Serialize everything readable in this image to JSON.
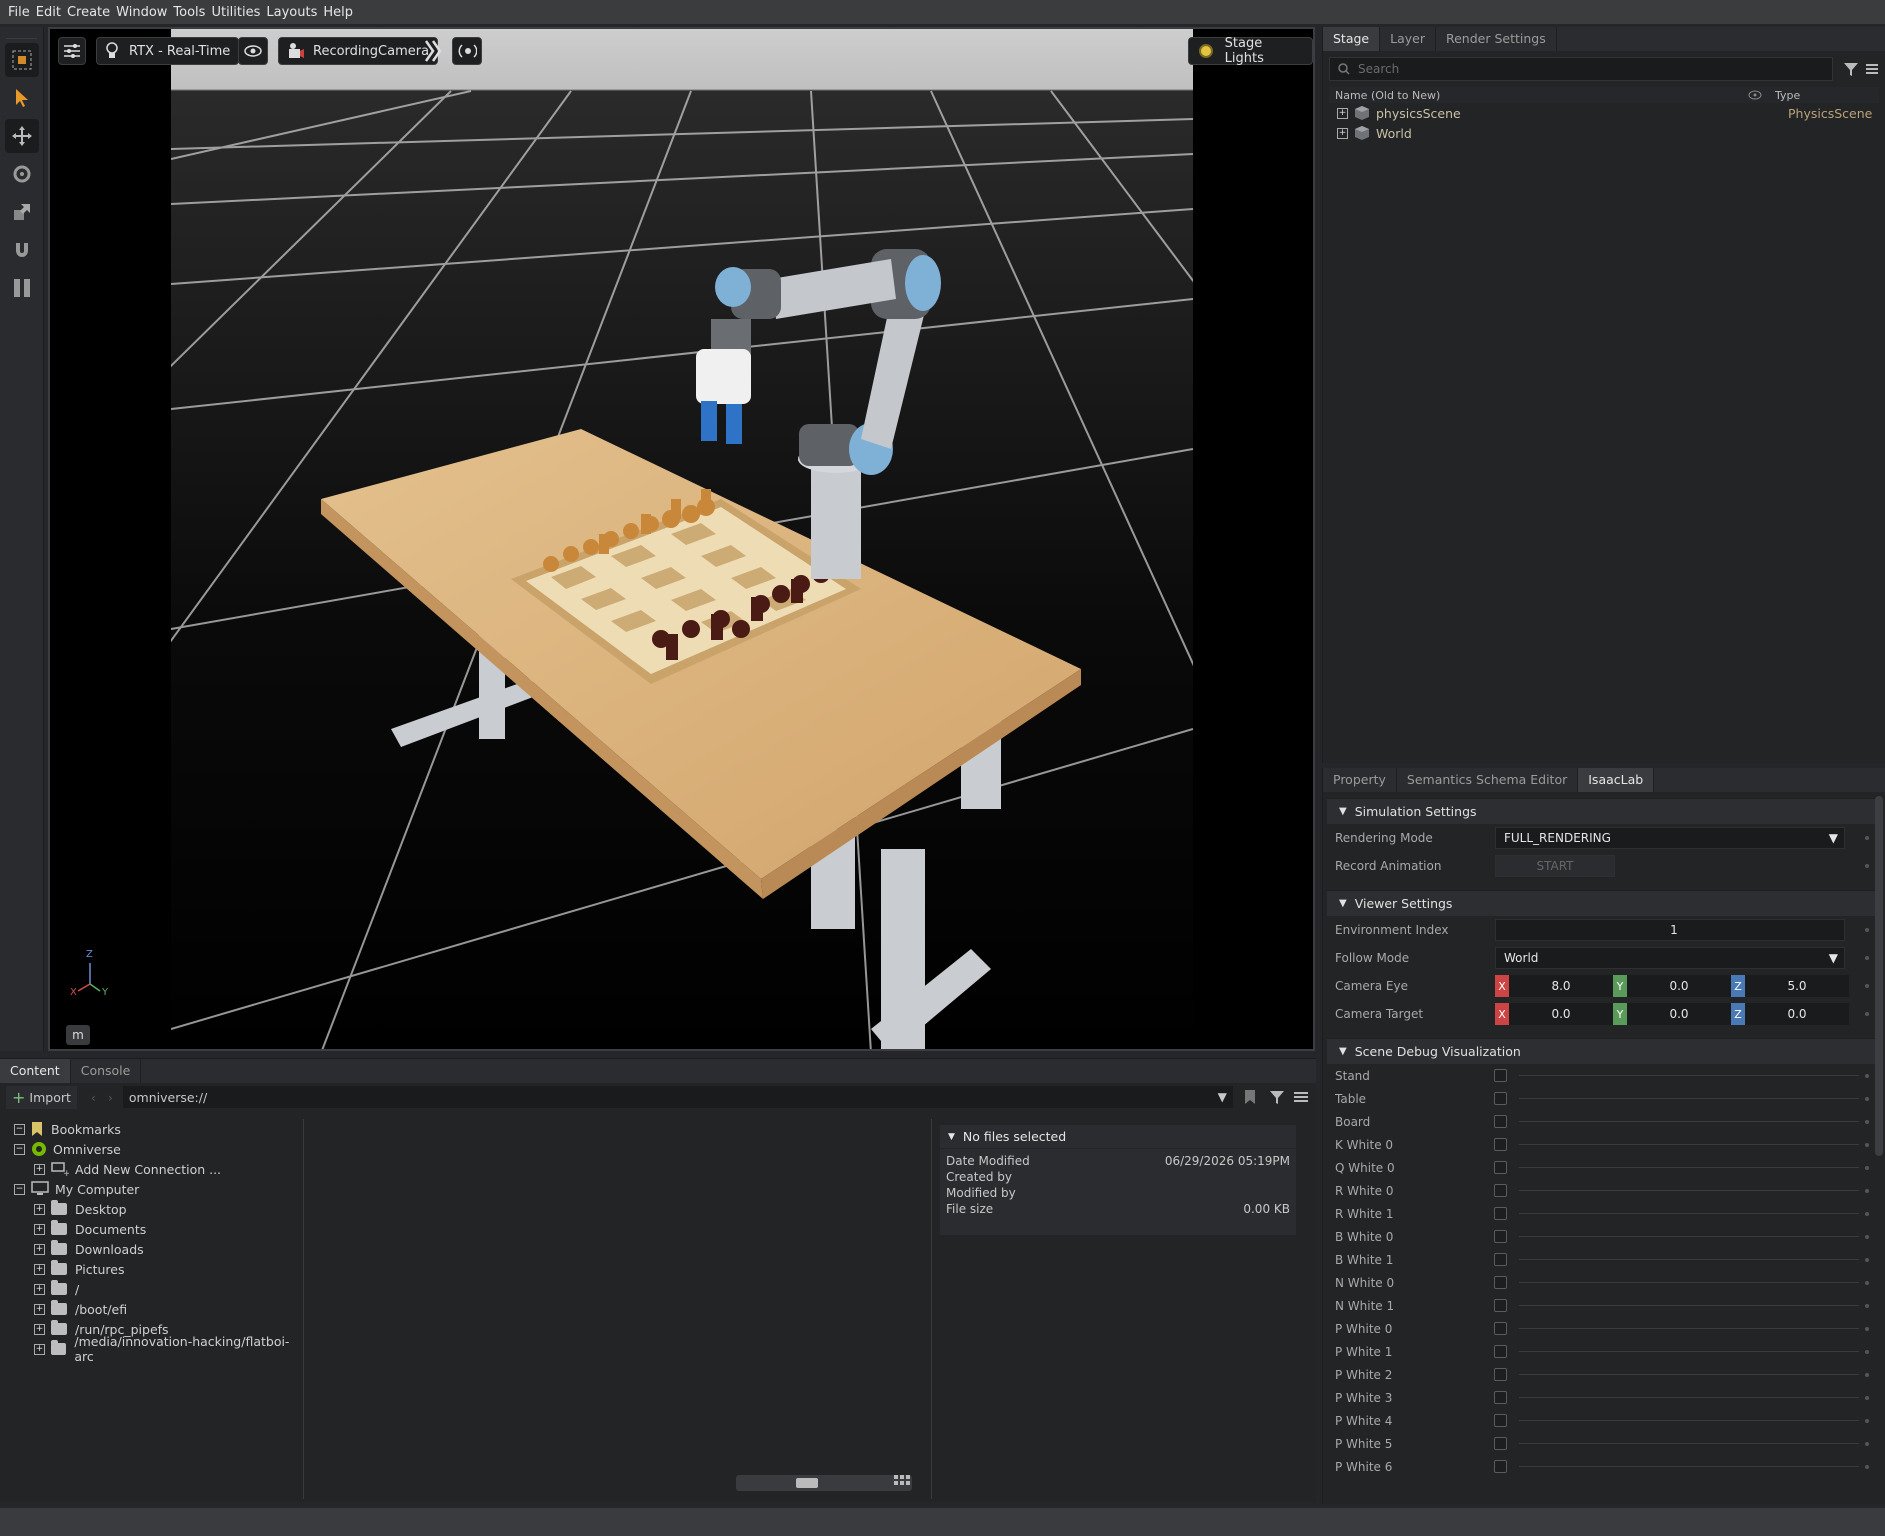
{
  "menubar": [
    "File",
    "Edit",
    "Create",
    "Window",
    "Tools",
    "Utilities",
    "Layouts",
    "Help"
  ],
  "viewport": {
    "render_mode": "RTX - Real-Time",
    "camera": "RecordingCamera",
    "stage_lights": "Stage Lights",
    "unit_badge": "m",
    "axis": {
      "z": "Z",
      "x": "X",
      "y": "Y"
    }
  },
  "stage": {
    "tabs": [
      "Stage",
      "Layer",
      "Render Settings"
    ],
    "search_placeholder": "Search",
    "col_name": "Name (Old to New)",
    "col_type": "Type",
    "items": [
      {
        "name": "physicsScene",
        "type": "PhysicsScene"
      },
      {
        "name": "World",
        "type": ""
      }
    ]
  },
  "props": {
    "tabs": [
      "Property",
      "Semantics Schema Editor",
      "IsaacLab"
    ],
    "sim_settings": "Simulation Settings",
    "rendering_mode_label": "Rendering Mode",
    "rendering_mode_value": "FULL_RENDERING",
    "record_animation_label": "Record Animation",
    "record_button": "START",
    "viewer_settings": "Viewer Settings",
    "env_index_label": "Environment Index",
    "env_index_value": "1",
    "follow_mode_label": "Follow Mode",
    "follow_mode_value": "World",
    "camera_eye_label": "Camera Eye",
    "camera_eye": [
      "8.0",
      "0.0",
      "5.0"
    ],
    "camera_target_label": "Camera Target",
    "camera_target": [
      "0.0",
      "0.0",
      "0.0"
    ],
    "axis_labels": [
      "X",
      "Y",
      "Z"
    ],
    "debug_viz": "Scene Debug Visualization",
    "debug_items": [
      "Stand",
      "Table",
      "Board",
      "K White 0",
      "Q White 0",
      "R White 0",
      "R White 1",
      "B White 0",
      "B White 1",
      "N White 0",
      "N White 1",
      "P White 0",
      "P White 1",
      "P White 2",
      "P White 3",
      "P White 4",
      "P White 5",
      "P White 6"
    ]
  },
  "content": {
    "tabs": [
      "Content",
      "Console"
    ],
    "import_label": "Import",
    "path": "omniverse://",
    "tree": [
      {
        "label": "Bookmarks",
        "level": 0,
        "exp": "−"
      },
      {
        "label": "Omniverse",
        "level": 0,
        "exp": "−"
      },
      {
        "label": "Add New Connection ...",
        "level": 1,
        "exp": "+"
      },
      {
        "label": "My Computer",
        "level": 0,
        "exp": "−"
      },
      {
        "label": "Desktop",
        "level": 1,
        "exp": "+"
      },
      {
        "label": "Documents",
        "level": 1,
        "exp": "+"
      },
      {
        "label": "Downloads",
        "level": 1,
        "exp": "+"
      },
      {
        "label": "Pictures",
        "level": 1,
        "exp": "+"
      },
      {
        "label": "/",
        "level": 1,
        "exp": "+"
      },
      {
        "label": "/boot/efi",
        "level": 1,
        "exp": "+"
      },
      {
        "label": "/run/rpc_pipefs",
        "level": 1,
        "exp": "+"
      },
      {
        "label": "/media/innovation-hacking/flatboi-arc",
        "level": 1,
        "exp": "+"
      }
    ],
    "details": {
      "header": "No files selected",
      "date_modified_label": "Date Modified",
      "date_modified": "06/29/2026 05:19PM",
      "created_by_label": "Created by",
      "modified_by_label": "Modified by",
      "file_size_label": "File size",
      "file_size": "0.00 KB"
    }
  }
}
